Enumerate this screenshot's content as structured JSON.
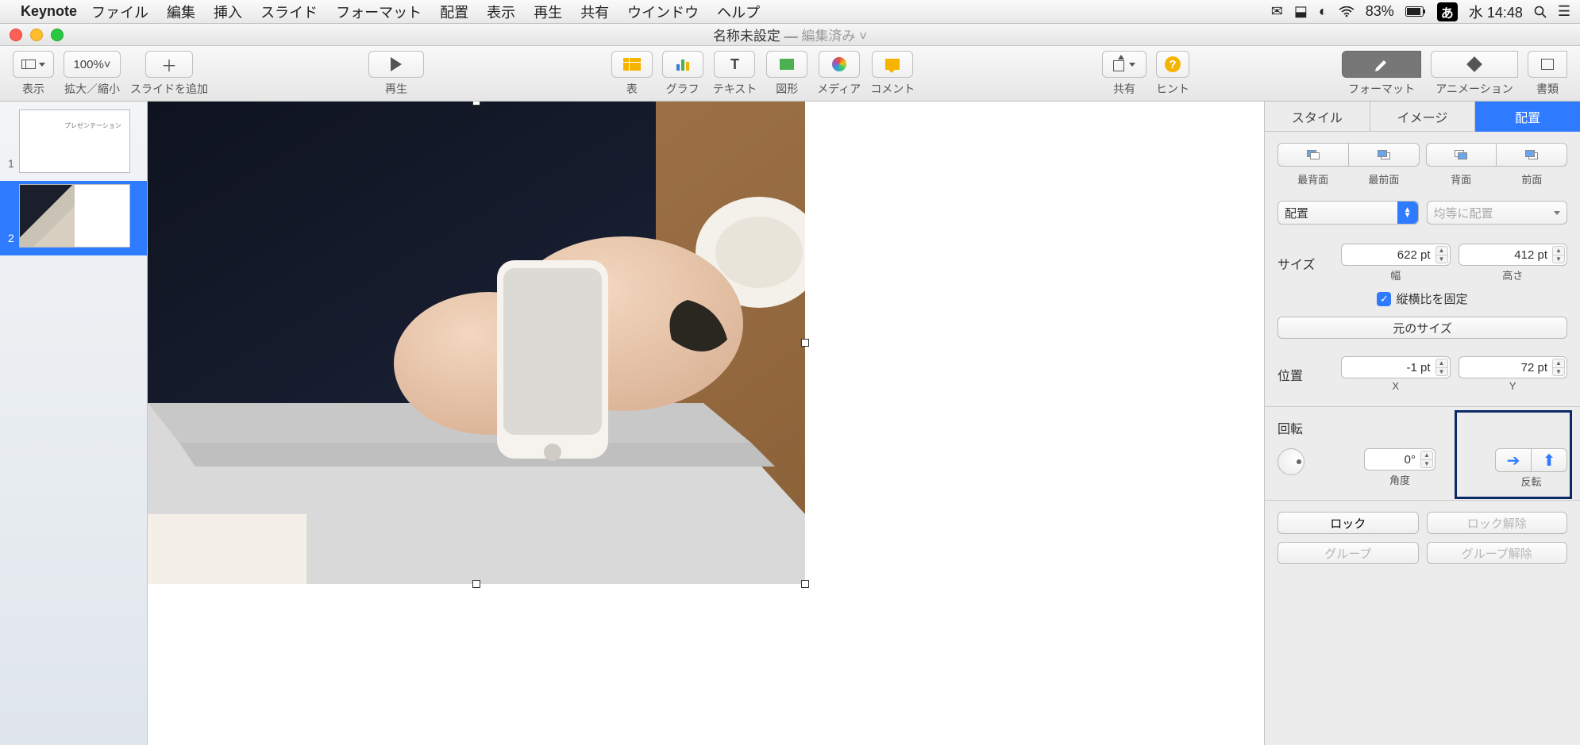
{
  "menubar": {
    "app": "Keynote",
    "menus": [
      "ファイル",
      "編集",
      "挿入",
      "スライド",
      "フォーマット",
      "配置",
      "表示",
      "再生",
      "共有",
      "ウインドウ",
      "ヘルプ"
    ],
    "battery": "83%",
    "ime": "あ",
    "clock": "水 14:48"
  },
  "titlebar": {
    "doc": "名称未設定",
    "sep": " — ",
    "edited": "編集済み ˅"
  },
  "toolbar": {
    "view": "表示",
    "zoom_val": "100%˅",
    "zoom": "拡大／縮小",
    "add": "スライドを追加",
    "play": "再生",
    "table": "表",
    "chart": "グラフ",
    "text": "テキスト",
    "shape": "図形",
    "media": "メディア",
    "comment": "コメント",
    "share": "共有",
    "hint": "ヒント",
    "format": "フォーマット",
    "anim": "アニメーション",
    "docs": "書類"
  },
  "slides": {
    "n1": "1",
    "n2": "2"
  },
  "inspector": {
    "tabs": {
      "style": "スタイル",
      "image": "イメージ",
      "arrange": "配置"
    },
    "order": {
      "back": "最背面",
      "front": "最前面",
      "backward": "背面",
      "forward": "前面"
    },
    "align_sel": "配置",
    "dist_sel": "均等に配置",
    "size": {
      "label": "サイズ",
      "w": "622 pt",
      "wl": "幅",
      "h": "412 pt",
      "hl": "高さ",
      "lock": "縦横比を固定",
      "orig": "元のサイズ"
    },
    "pos": {
      "label": "位置",
      "x": "-1 pt",
      "xl": "X",
      "y": "72 pt",
      "yl": "Y"
    },
    "rot": {
      "label": "回転",
      "angle": "0°",
      "al": "角度",
      "fl": "反転"
    },
    "lock": "ロック",
    "unlock": "ロック解除",
    "group": "グループ",
    "ungroup": "グループ解除"
  }
}
